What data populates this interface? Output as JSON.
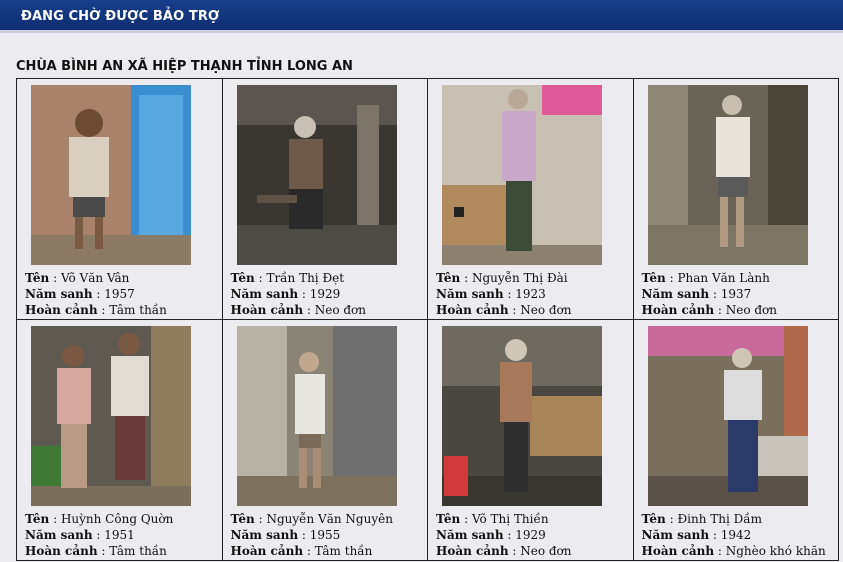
{
  "header": {
    "title": "ĐANG CHỜ ĐƯỢC BẢO TRỢ"
  },
  "section": {
    "title": "CHÙA BÌNH AN XÃ HIỆP THẠNH TỈNH LONG AN"
  },
  "labels": {
    "name": "Tên",
    "birth_year": "Năm sanh",
    "situation": "Hoàn cảnh"
  },
  "people": [
    {
      "name": "Võ Văn Vân",
      "birth_year": "1957",
      "situation": "Tâm thần"
    },
    {
      "name": "Trần Thị Đẹt",
      "birth_year": "1929",
      "situation": "Neo đơn"
    },
    {
      "name": "Nguyễn Thị Đài",
      "birth_year": "1923",
      "situation": "Neo đơn"
    },
    {
      "name": "Phan Văn Lành",
      "birth_year": "1937",
      "situation": "Neo đơn"
    },
    {
      "name": "Huỳnh Công Quờn",
      "birth_year": "1951",
      "situation": "Tâm thần"
    },
    {
      "name": "Nguyễn Văn Nguyên",
      "birth_year": "1955",
      "situation": "Tâm thần"
    },
    {
      "name": "Võ Thị Thiền",
      "birth_year": "1929",
      "situation": "Neo đơn"
    },
    {
      "name": "Đinh Thị Dầm",
      "birth_year": "1942",
      "situation": "Nghèo khó khăn"
    }
  ],
  "colors": {
    "header_bg": "#173f8a",
    "page_bg": "#ecebf0",
    "grid_border": "#222222"
  }
}
